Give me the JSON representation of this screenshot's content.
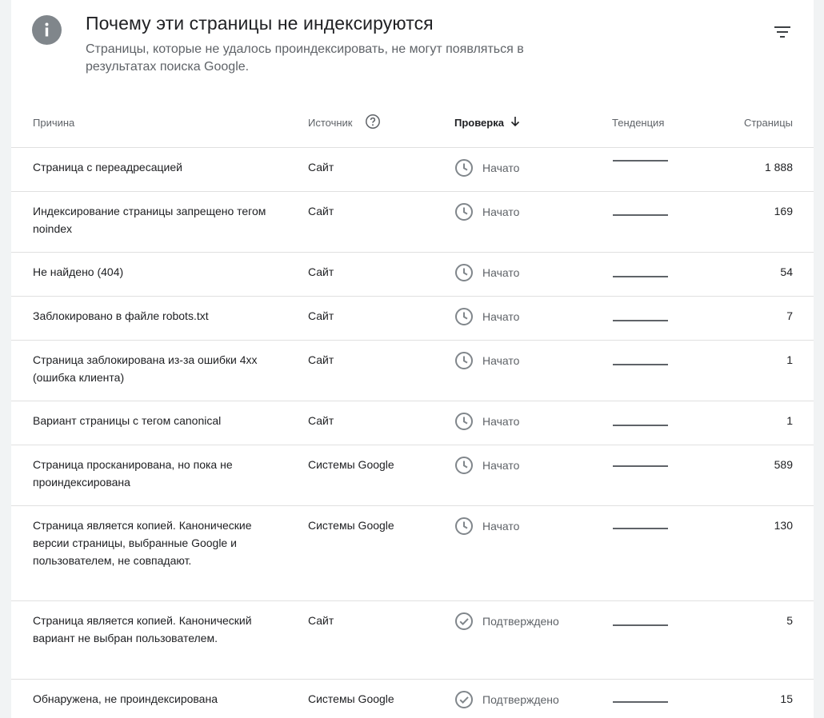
{
  "header": {
    "title": "Почему эти страницы не индексируются",
    "subtitle": "Страницы, которые не удалось проиндексировать, не могут появляться в результатах поиска Google."
  },
  "columns": {
    "reason": "Причина",
    "source": "Источник",
    "check": "Проверка",
    "trend": "Тенденция",
    "pages": "Страницы"
  },
  "rows": [
    {
      "reason": "Страница с переадресацией",
      "source": "Сайт",
      "status": "Начато",
      "status_type": "clock",
      "pages": "1 888"
    },
    {
      "reason": "Индексирование страницы запрещено тегом noindex",
      "source": "Сайт",
      "status": "Начато",
      "status_type": "clock",
      "pages": "169"
    },
    {
      "reason": "Не найдено (404)",
      "source": "Сайт",
      "status": "Начато",
      "status_type": "clock",
      "pages": "54"
    },
    {
      "reason": "Заблокировано в файле robots.txt",
      "source": "Сайт",
      "status": "Начато",
      "status_type": "clock",
      "pages": "7"
    },
    {
      "reason": "Страница заблокирована из-за ошибки 4xx (ошибка клиента)",
      "source": "Сайт",
      "status": "Начато",
      "status_type": "clock",
      "pages": "1"
    },
    {
      "reason": "Вариант страницы с тегом canonical",
      "source": "Сайт",
      "status": "Начато",
      "status_type": "clock",
      "pages": "1"
    },
    {
      "reason": "Страница просканирована, но пока не проиндексирована",
      "source": "Системы Google",
      "status": "Начато",
      "status_type": "clock",
      "pages": "589"
    },
    {
      "reason": "Страница является копией. Канонические версии страницы, выбранные Google и пользователем, не совпадают.",
      "source": "Системы Google",
      "status": "Начато",
      "status_type": "clock",
      "pages": "130"
    },
    {
      "reason": "Страница является копией. Канонический вариант не выбран пользователем.",
      "source": "Сайт",
      "status": "Подтверждено",
      "status_type": "check",
      "pages": "5"
    },
    {
      "reason": "Обнаружена, не проиндексирована",
      "source": "Системы Google",
      "status": "Подтверждено",
      "status_type": "check",
      "pages": "15"
    }
  ],
  "icons": {
    "header": "info-icon",
    "filter": "filter-icon",
    "help": "help-circle-icon",
    "sort": "arrow-down-icon",
    "clock": "clock-icon",
    "check": "check-circle-icon"
  },
  "colors": {
    "icon_gray": "#80868b",
    "secondary_text": "#5f6368",
    "primary_text": "#202124"
  }
}
